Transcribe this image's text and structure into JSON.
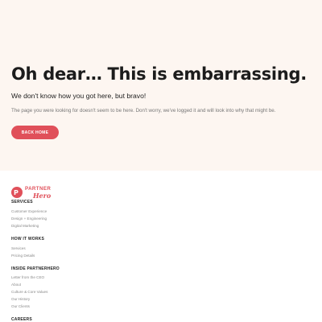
{
  "hero": {
    "title": "Oh dear… This is embarrassing.",
    "subtitle": "We don't know how you got here, but bravo!",
    "description": "The page you were looking for doesn't seem to be here. Don't worry, we've logged it and will look into why that might be.",
    "button_label": "BACK HOME"
  },
  "logo": {
    "word_top": "PARTNER",
    "word_bottom": "Hero"
  },
  "footer": {
    "services": {
      "heading": "SERVICES",
      "links": [
        "Customer Experience",
        "Design + Engineering",
        "Digital Marketing"
      ]
    },
    "how_it_works": {
      "heading": "HOW IT WORKS",
      "links": [
        "Services",
        "Pricing Details"
      ]
    },
    "inside": {
      "heading": "INSIDE PARTNERHERO",
      "links": [
        "Letter from the CEO",
        "About",
        "Culture & Core Values",
        "Our History",
        "Our Clients"
      ]
    },
    "careers": {
      "heading": "CAREERS"
    }
  },
  "colors": {
    "accent": "#e0505a",
    "hero_background": "#fdf6f1"
  }
}
